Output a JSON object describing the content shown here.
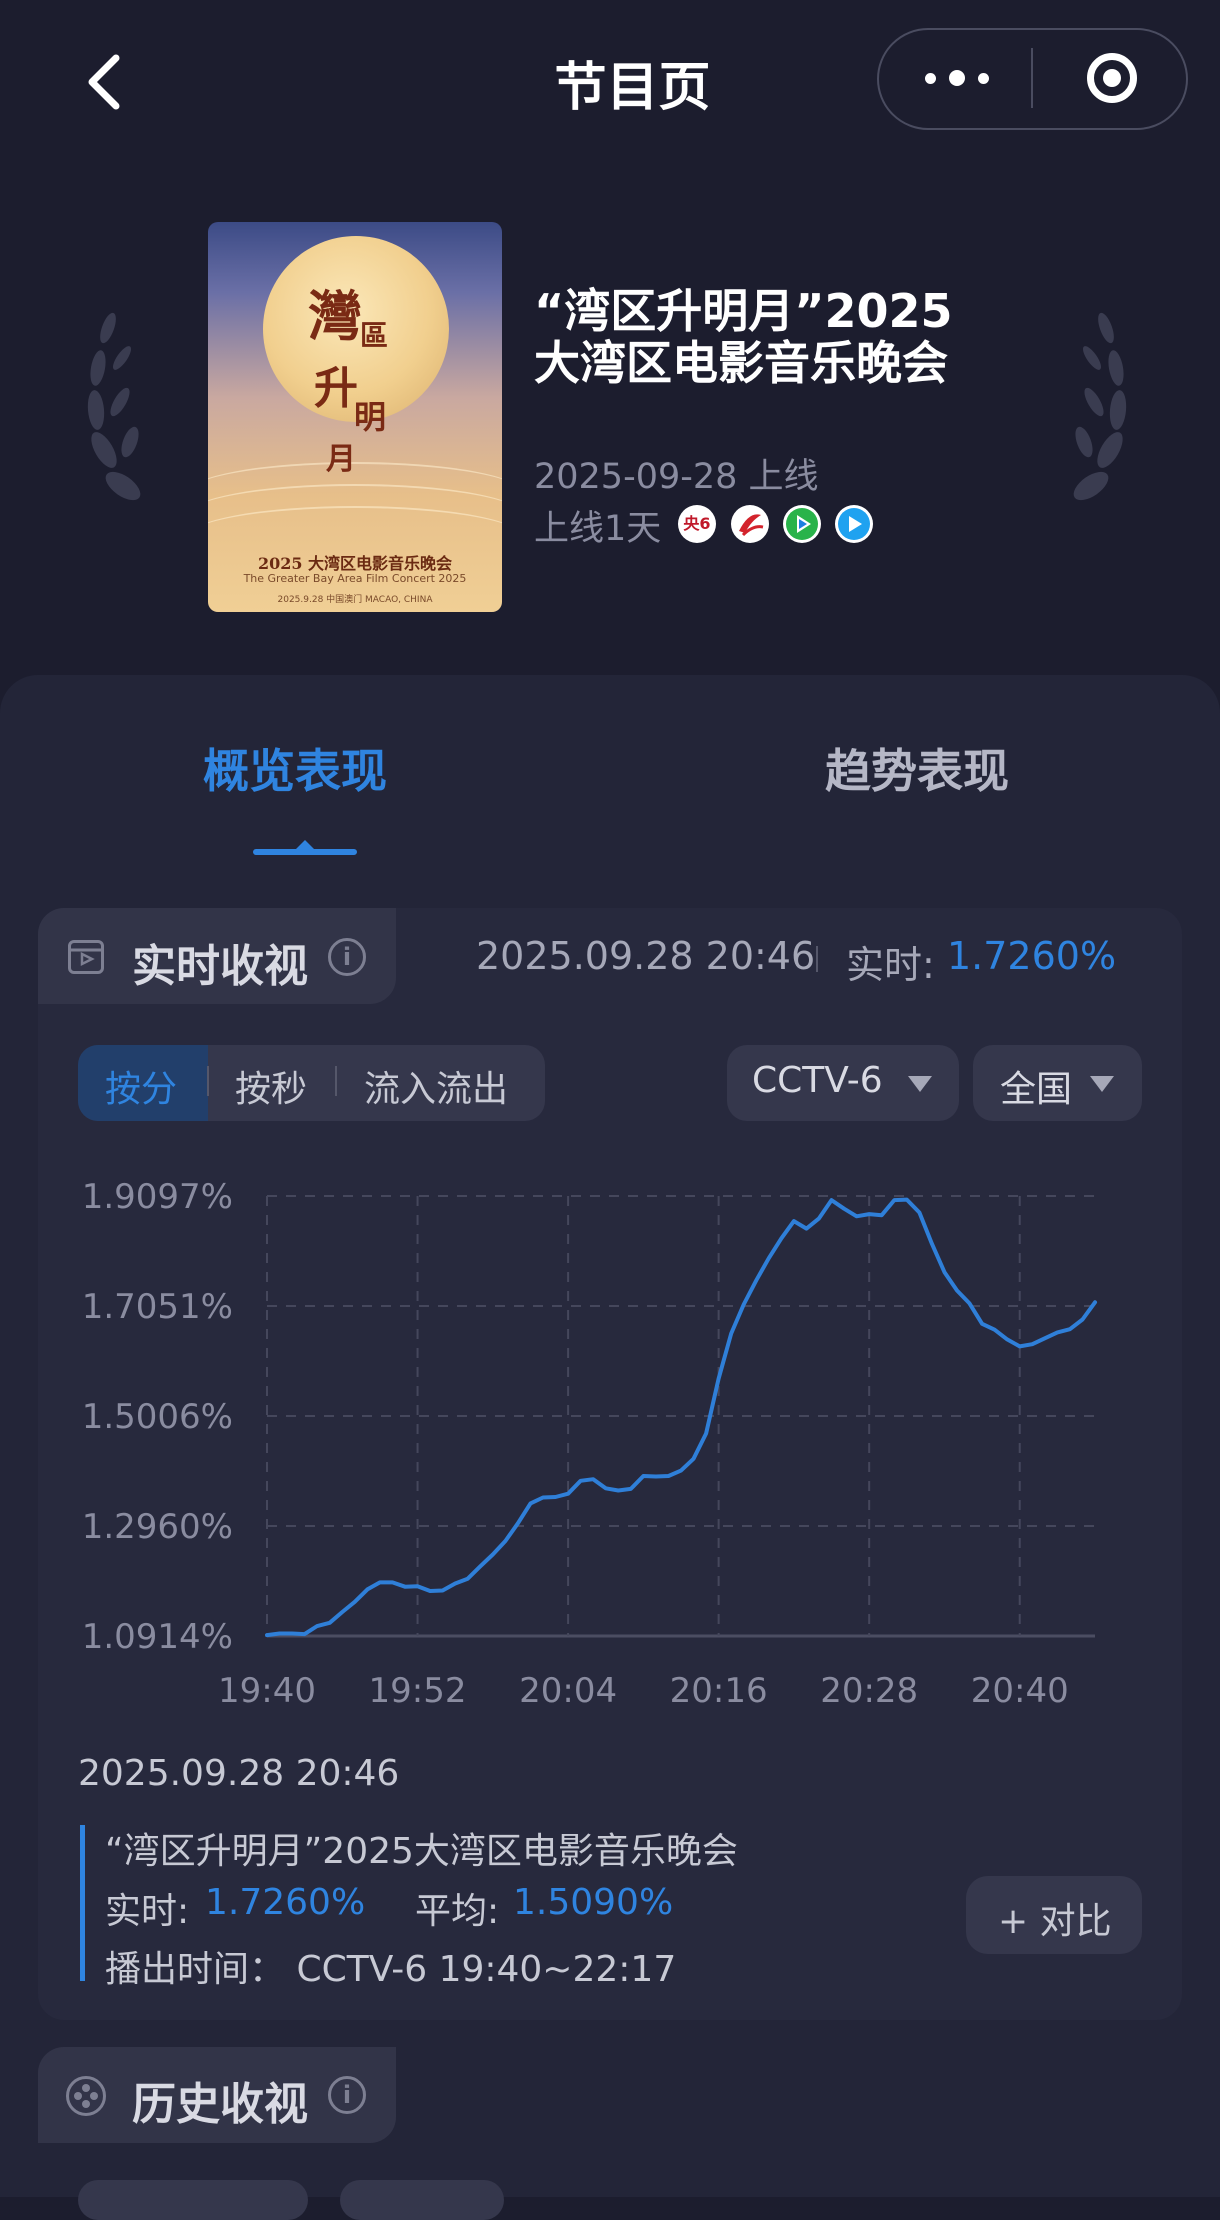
{
  "header": {
    "title": "节目页",
    "back_icon": "chevron-left-icon",
    "more_icon": "more-dots-icon",
    "close_icon": "record-target-icon"
  },
  "program": {
    "title_line1": "“湾区升明月”2025",
    "title_line2": "大湾区电影音乐晚会",
    "release_date": "2025-09-28 上线",
    "days_online": "上线1天",
    "channel_icons": [
      "cctv6-logo-icon",
      "gdtv-logo-icon",
      "tencent-video-icon",
      "youku-icon"
    ],
    "poster": {
      "calligraphy_1": "灣",
      "calligraphy_2": "區",
      "calligraphy_3": "升",
      "calligraphy_4": "明",
      "calligraphy_5": "月",
      "cn": "2025 大湾区电影音乐晚会",
      "en": "The Greater Bay Area Film Concert 2025",
      "date": "2025.9.28 中国澳门 MACAO, CHINA"
    }
  },
  "tabs": {
    "overview": "概览表现",
    "trend": "趋势表现",
    "active": "overview"
  },
  "realtime": {
    "label": "实时收视",
    "info_icon": "i",
    "timestamp": "2025.09.28 20:46",
    "rt_label": "实时:",
    "rt_value": "1.7260%",
    "segments": {
      "by_minute": "按分",
      "by_second": "按秒",
      "flow": "流入流出",
      "active": "by_minute"
    },
    "channel_select": "CCTV-6",
    "region_select": "全国"
  },
  "chart_data": {
    "type": "line",
    "y_ticks": [
      "1.9097%",
      "1.7051%",
      "1.5006%",
      "1.2960%",
      "1.0914%"
    ],
    "ylim": [
      1.0914,
      1.9097
    ],
    "x_ticks": [
      "19:40",
      "19:52",
      "20:04",
      "20:16",
      "20:28",
      "20:40"
    ],
    "xlim": [
      0,
      66
    ],
    "grid": true,
    "line_color": "#2f7fd8",
    "series": [
      {
        "x": [
          0,
          1,
          2,
          3,
          4,
          5,
          6,
          7,
          8,
          9,
          10,
          11,
          12,
          13,
          14,
          15,
          16,
          17,
          18,
          19,
          20,
          21,
          22,
          23,
          24,
          25,
          26,
          27,
          28,
          29,
          30,
          31,
          32,
          33,
          34,
          35,
          36,
          37,
          38,
          39,
          40,
          41,
          42,
          43,
          44,
          45,
          46,
          47,
          48,
          49,
          50,
          51,
          52,
          53,
          54,
          55,
          56,
          57,
          58,
          59,
          60,
          61,
          62,
          63,
          64,
          65,
          66
        ],
        "values": [
          1.093,
          1.096,
          1.096,
          1.095,
          1.11,
          1.116,
          1.136,
          1.155,
          1.178,
          1.191,
          1.191,
          1.183,
          1.184,
          1.175,
          1.176,
          1.189,
          1.198,
          1.221,
          1.243,
          1.268,
          1.301,
          1.338,
          1.349,
          1.35,
          1.356,
          1.38,
          1.383,
          1.366,
          1.362,
          1.365,
          1.389,
          1.388,
          1.389,
          1.399,
          1.421,
          1.468,
          1.57,
          1.654,
          1.708,
          1.753,
          1.794,
          1.831,
          1.863,
          1.849,
          1.868,
          1.902,
          1.886,
          1.872,
          1.876,
          1.874,
          1.902,
          1.903,
          1.879,
          1.821,
          1.768,
          1.734,
          1.71,
          1.672,
          1.661,
          1.643,
          1.63,
          1.634,
          1.645,
          1.656,
          1.662,
          1.68,
          1.712
        ]
      }
    ]
  },
  "selection": {
    "timestamp": "2025.09.28 20:46",
    "program_name": "“湾区升明月”2025大湾区电影音乐晚会",
    "rt_label": "实时:",
    "rt_value": "1.7260%",
    "avg_label": "平均:",
    "avg_value": "1.5090%",
    "airtime": "播出时间：  CCTV-6 19:40~22:17",
    "compare_button": "+ 对比"
  },
  "history": {
    "label": "历史收视",
    "info_icon": "i",
    "icon": "film-reel-icon"
  }
}
